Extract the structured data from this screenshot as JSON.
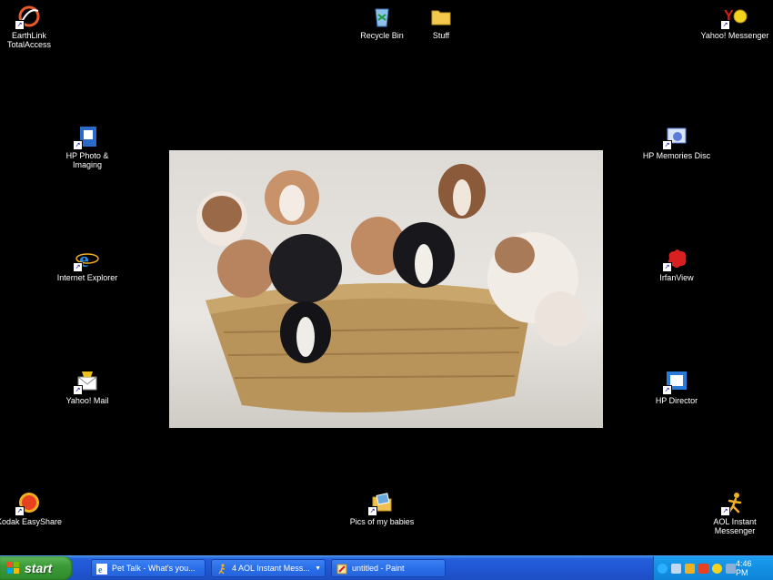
{
  "desktop": {
    "icons": [
      {
        "id": "earthlink",
        "label": "EarthLink TotalAccess",
        "glyph": "earthlink-icon",
        "color": "#e85a2a"
      },
      {
        "id": "recycle",
        "label": "Recycle Bin",
        "glyph": "recycle-bin-icon",
        "color": "#5aa0d8"
      },
      {
        "id": "stuff",
        "label": "Stuff",
        "glyph": "folder-icon",
        "color": "#f2c94c"
      },
      {
        "id": "yahoo-messenger",
        "label": "Yahoo! Messenger",
        "glyph": "yahoo-messenger-icon",
        "color": "#e8d020"
      },
      {
        "id": "hp-photo",
        "label": "HP Photo & Imaging",
        "glyph": "hp-photo-icon",
        "color": "#2a6ac8"
      },
      {
        "id": "hp-memories",
        "label": "HP Memories Disc",
        "glyph": "hp-memories-disc-icon",
        "color": "#5b7bd8"
      },
      {
        "id": "ie",
        "label": "Internet Explorer",
        "glyph": "internet-explorer-icon",
        "color": "#2a88e0"
      },
      {
        "id": "irfanview",
        "label": "IrfanView",
        "glyph": "irfanview-icon",
        "color": "#d82020"
      },
      {
        "id": "yahoo-mail",
        "label": "Yahoo! Mail",
        "glyph": "yahoo-mail-icon",
        "color": "#e8c020"
      },
      {
        "id": "hp-director",
        "label": "HP Director",
        "glyph": "hp-director-icon",
        "color": "#2a7ad8"
      },
      {
        "id": "kodak",
        "label": "Kodak EasyShare",
        "glyph": "kodak-easyshare-icon",
        "color": "#e84020"
      },
      {
        "id": "pics",
        "label": "Pics of my babies",
        "glyph": "picture-folder-icon",
        "color": "#f0c050"
      },
      {
        "id": "aim",
        "label": "AOL Instant Messenger",
        "glyph": "aim-icon",
        "color": "#f0b020"
      }
    ]
  },
  "taskbar": {
    "start_label": "start",
    "tasks": [
      {
        "label": "Pet Talk - What's you...",
        "glyph": "ie-page-icon"
      },
      {
        "label": "4 AOL Instant Mess...",
        "glyph": "aim-running-man-icon",
        "caret": "▼"
      },
      {
        "label": "untitled - Paint",
        "glyph": "paint-icon"
      }
    ],
    "clock": "4:46 PM"
  }
}
